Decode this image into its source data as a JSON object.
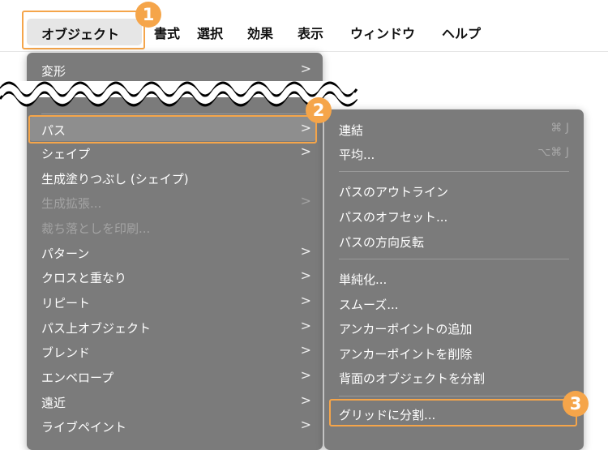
{
  "menubar": {
    "items": [
      "オブジェクト",
      "書式",
      "選択",
      "効果",
      "表示",
      "ウィンドウ",
      "ヘルプ"
    ]
  },
  "badges": [
    "1",
    "2",
    "3"
  ],
  "object_menu": [
    {
      "label": "変形",
      "submenu": true
    },
    {
      "label": "パス",
      "submenu": true,
      "selected": true
    },
    {
      "label": "シェイプ",
      "submenu": true
    },
    {
      "label": "生成塗りつぶし (シェイプ)",
      "submenu": false
    },
    {
      "label": "生成拡張...",
      "submenu": true,
      "disabled": true
    },
    {
      "label": "裁ち落としを印刷...",
      "submenu": false,
      "disabled": true
    },
    {
      "label": "パターン",
      "submenu": true
    },
    {
      "label": "クロスと重なり",
      "submenu": true
    },
    {
      "label": "リピート",
      "submenu": true
    },
    {
      "label": "パス上オブジェクト",
      "submenu": true
    },
    {
      "label": "ブレンド",
      "submenu": true
    },
    {
      "label": "エンベロープ",
      "submenu": true
    },
    {
      "label": "遠近",
      "submenu": true
    },
    {
      "label": "ライブペイント",
      "submenu": true
    }
  ],
  "path_submenu": [
    {
      "label": "連結",
      "shortcut": "⌘ J"
    },
    {
      "label": "平均...",
      "shortcut": "⌥⌘ J"
    },
    {
      "label": "パスのアウトライン"
    },
    {
      "label": "パスのオフセット..."
    },
    {
      "label": "パスの方向反転"
    },
    {
      "label": "単純化..."
    },
    {
      "label": "スムーズ..."
    },
    {
      "label": "アンカーポイントの追加"
    },
    {
      "label": "アンカーポイントを削除"
    },
    {
      "label": "背面のオブジェクトを分割"
    },
    {
      "label": "グリッドに分割..."
    }
  ],
  "chevron": ">"
}
